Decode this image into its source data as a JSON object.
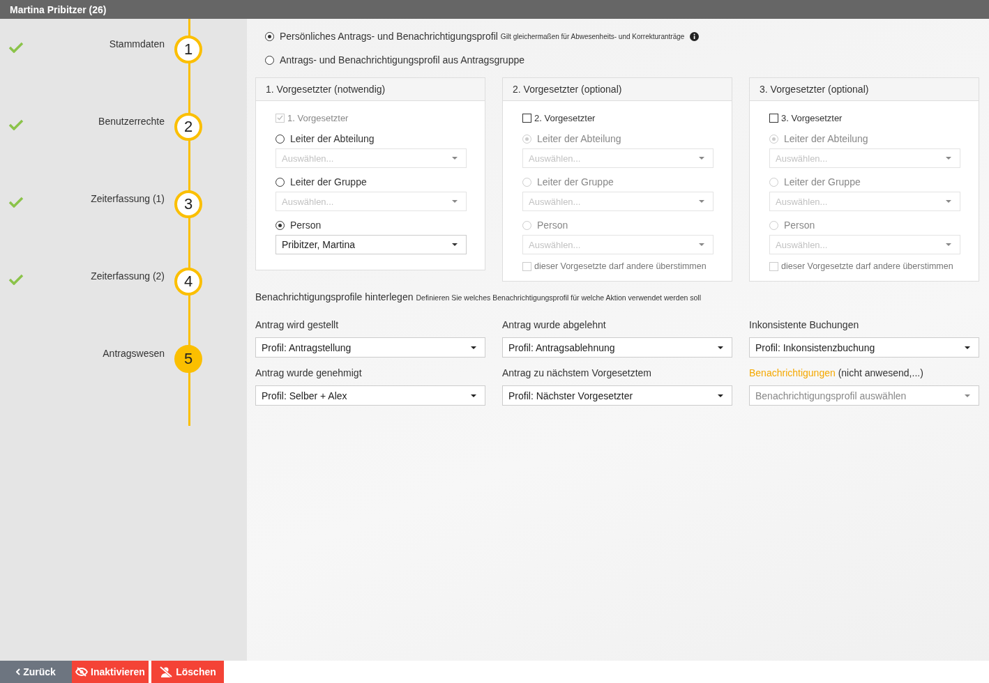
{
  "header": {
    "title": "Martina Pribitzer (26)"
  },
  "steps": [
    {
      "number": "1",
      "label": "Stammdaten",
      "done": true,
      "selected": false
    },
    {
      "number": "2",
      "label": "Benutzerrechte",
      "done": true,
      "selected": false
    },
    {
      "number": "3",
      "label": "Zeiterfassung (1)",
      "done": true,
      "selected": false
    },
    {
      "number": "4",
      "label": "Zeiterfassung (2)",
      "done": true,
      "selected": false
    },
    {
      "number": "5",
      "label": "Antragswesen",
      "done": false,
      "selected": true
    }
  ],
  "profile_options": [
    {
      "label": "Persönliches Antrags- und Benachrichtigungsprofil",
      "note": "Gilt gleichermaßen für Abwesenheits- und Korrekturanträge",
      "info": true,
      "selected": true
    },
    {
      "label": "Antrags- und Benachrichtigungsprofil aus Antragsgruppe",
      "info": false,
      "selected": false
    }
  ],
  "supervisors": [
    {
      "title": "1. Vorgesetzter (notwendig)",
      "checkbox": {
        "label": "1. Vorgesetzter",
        "checked": true,
        "disabled": true
      },
      "disabled": false,
      "options": [
        {
          "label": "Leiter der Abteilung",
          "selected": false,
          "select": {
            "placeholder": "Auswählen..."
          }
        },
        {
          "label": "Leiter der Gruppe",
          "selected": false,
          "select": {
            "placeholder": "Auswählen..."
          }
        },
        {
          "label": "Person",
          "selected": true,
          "select": {
            "value": "Pribitzer, Martina"
          }
        }
      ]
    },
    {
      "title": "2. Vorgesetzter (optional)",
      "checkbox": {
        "label": "2. Vorgesetzter",
        "checked": false,
        "disabled": false
      },
      "disabled": true,
      "options": [
        {
          "label": "Leiter der Abteilung",
          "selected": true,
          "select": {
            "placeholder": "Auswählen..."
          }
        },
        {
          "label": "Leiter der Gruppe",
          "selected": false,
          "select": {
            "placeholder": "Auswählen..."
          }
        },
        {
          "label": "Person",
          "selected": false,
          "select": {
            "placeholder": "Auswählen..."
          }
        }
      ],
      "override": {
        "label": "dieser Vorgesetzte darf andere überstimmen",
        "checked": false
      }
    },
    {
      "title": "3. Vorgesetzter (optional)",
      "checkbox": {
        "label": "3. Vorgesetzter",
        "checked": false,
        "disabled": false
      },
      "disabled": true,
      "options": [
        {
          "label": "Leiter der Abteilung",
          "selected": true,
          "select": {
            "placeholder": "Auswählen..."
          }
        },
        {
          "label": "Leiter der Gruppe",
          "selected": false,
          "select": {
            "placeholder": "Auswählen..."
          }
        },
        {
          "label": "Person",
          "selected": false,
          "select": {
            "placeholder": "Auswählen..."
          }
        }
      ],
      "override": {
        "label": "dieser Vorgesetzte darf andere überstimmen",
        "checked": false
      }
    }
  ],
  "notifications": {
    "title": "Benachrichtigungsprofile hinterlegen",
    "description": "Definieren Sie welches Benachrichtigungsprofil für welche Aktion verwendet werden soll",
    "fields": [
      {
        "label": "Antrag wird gestellt",
        "value": "Profil: Antragstellung"
      },
      {
        "label": "Antrag wurde abgelehnt",
        "value": "Profil: Antragsablehnung"
      },
      {
        "label": "Inkonsistente Buchungen",
        "value": "Profil: Inkonsistenzbuchung"
      },
      {
        "label": "Antrag wurde genehmigt",
        "value": "Profil: Selber + Alex"
      },
      {
        "label": "Antrag zu nächstem Vorgesetztem",
        "value": "Profil: Nächster Vorgesetzter"
      },
      {
        "link": "Benachrichtigungen",
        "label": "(nicht anwesend,...)",
        "placeholder": "Benachrichtigungsprofil auswählen"
      }
    ]
  },
  "footer_buttons": [
    {
      "kind": "back",
      "label": "Zurück"
    },
    {
      "kind": "inactivate",
      "label": "Inaktivieren"
    },
    {
      "kind": "delete",
      "label": "Löschen"
    }
  ]
}
